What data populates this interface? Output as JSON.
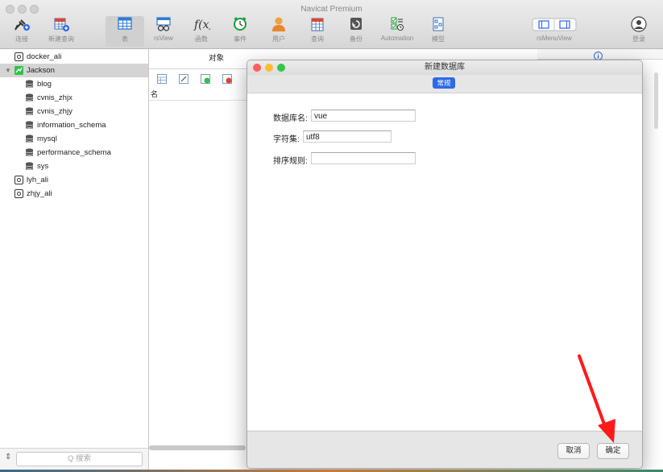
{
  "app": {
    "title": "Navicat Premium"
  },
  "toolbar": {
    "items": [
      {
        "label": "连接",
        "icon": "plug-icon"
      },
      {
        "label": "新建查询",
        "icon": "new-query-icon"
      },
      {
        "label": "表",
        "icon": "table-icon"
      },
      {
        "label": "rsView",
        "icon": "view-icon"
      },
      {
        "label": "函数",
        "icon": "function-icon"
      },
      {
        "label": "事件",
        "icon": "alarm-clock-icon"
      },
      {
        "label": "用户",
        "icon": "user-icon"
      },
      {
        "label": "查询",
        "icon": "query-icon"
      },
      {
        "label": "备份",
        "icon": "backup-icon"
      },
      {
        "label": "Automation",
        "icon": "automation-icon"
      },
      {
        "label": "模型",
        "icon": "model-icon"
      },
      {
        "label": "rsMenuView",
        "icon": "layout-icon"
      },
      {
        "label": "登录",
        "icon": "account-icon"
      }
    ]
  },
  "sidebar": {
    "connections": [
      {
        "label": "docker_ali"
      },
      {
        "label": "Jackson",
        "expanded": true,
        "selected": true
      },
      {
        "label": "blog"
      },
      {
        "label": "cvnis_zhjx"
      },
      {
        "label": "cvnis_zhjy"
      },
      {
        "label": "information_schema"
      },
      {
        "label": "mysql"
      },
      {
        "label": "performance_schema"
      },
      {
        "label": "sys"
      },
      {
        "label": "lyh_ali"
      },
      {
        "label": "zhjy_ali"
      }
    ],
    "search_placeholder": "Q 搜索"
  },
  "objects": {
    "tab_label": "对象",
    "column_name": "名"
  },
  "dialog": {
    "title": "新建数据库",
    "tab": "常规",
    "fields": {
      "db_name_label": "数据库名:",
      "db_name_value": "vue",
      "charset_label": "字符集:",
      "charset_value": "utf8",
      "collation_label": "排序规则:",
      "collation_value": ""
    },
    "cancel_label": "取消",
    "ok_label": "确定"
  },
  "colors": {
    "accent": "#2d69e8",
    "arrow": "#ff1a1a",
    "close": "#fc5f57",
    "minimize": "#fdbc2e",
    "zoom": "#33c748",
    "connection_active": "#2ec24a"
  }
}
